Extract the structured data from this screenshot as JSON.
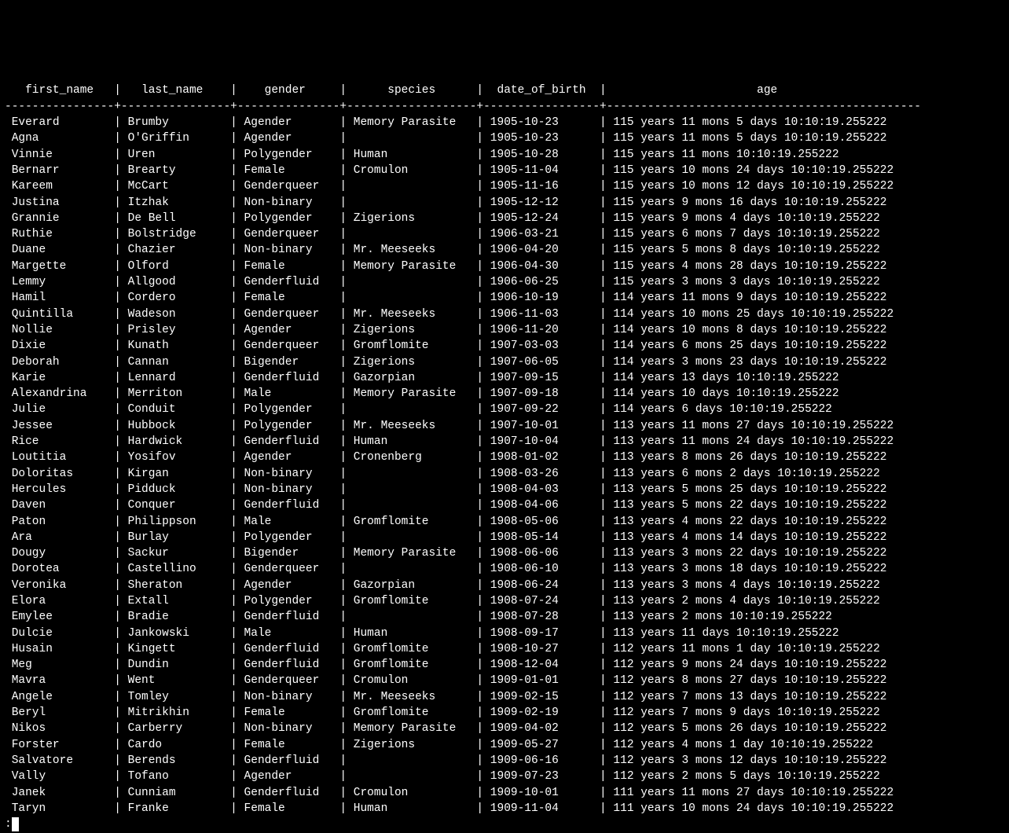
{
  "prompt": ":",
  "columns": [
    {
      "name": "first_name",
      "width": 14,
      "align": "left",
      "header_align": "center"
    },
    {
      "name": "last_name",
      "width": 14,
      "align": "left",
      "header_align": "center"
    },
    {
      "name": "gender",
      "width": 13,
      "align": "left",
      "header_align": "center"
    },
    {
      "name": "species",
      "width": 17,
      "align": "left",
      "header_align": "center"
    },
    {
      "name": "date_of_birth",
      "width": 15,
      "align": "left",
      "header_align": "center"
    },
    {
      "name": "age",
      "width": 45,
      "align": "left",
      "header_align": "center"
    }
  ],
  "rows": [
    {
      "first_name": "Everard",
      "last_name": "Brumby",
      "gender": "Agender",
      "species": "Memory Parasite",
      "date_of_birth": "1905-10-23",
      "age": "115 years 11 mons 5 days 10:10:19.255222"
    },
    {
      "first_name": "Agna",
      "last_name": "O'Griffin",
      "gender": "Agender",
      "species": "",
      "date_of_birth": "1905-10-23",
      "age": "115 years 11 mons 5 days 10:10:19.255222"
    },
    {
      "first_name": "Vinnie",
      "last_name": "Uren",
      "gender": "Polygender",
      "species": "Human",
      "date_of_birth": "1905-10-28",
      "age": "115 years 11 mons 10:10:19.255222"
    },
    {
      "first_name": "Bernarr",
      "last_name": "Brearty",
      "gender": "Female",
      "species": "Cromulon",
      "date_of_birth": "1905-11-04",
      "age": "115 years 10 mons 24 days 10:10:19.255222"
    },
    {
      "first_name": "Kareem",
      "last_name": "McCart",
      "gender": "Genderqueer",
      "species": "",
      "date_of_birth": "1905-11-16",
      "age": "115 years 10 mons 12 days 10:10:19.255222"
    },
    {
      "first_name": "Justina",
      "last_name": "Itzhak",
      "gender": "Non-binary",
      "species": "",
      "date_of_birth": "1905-12-12",
      "age": "115 years 9 mons 16 days 10:10:19.255222"
    },
    {
      "first_name": "Grannie",
      "last_name": "De Bell",
      "gender": "Polygender",
      "species": "Zigerions",
      "date_of_birth": "1905-12-24",
      "age": "115 years 9 mons 4 days 10:10:19.255222"
    },
    {
      "first_name": "Ruthie",
      "last_name": "Bolstridge",
      "gender": "Genderqueer",
      "species": "",
      "date_of_birth": "1906-03-21",
      "age": "115 years 6 mons 7 days 10:10:19.255222"
    },
    {
      "first_name": "Duane",
      "last_name": "Chazier",
      "gender": "Non-binary",
      "species": "Mr. Meeseeks",
      "date_of_birth": "1906-04-20",
      "age": "115 years 5 mons 8 days 10:10:19.255222"
    },
    {
      "first_name": "Margette",
      "last_name": "Olford",
      "gender": "Female",
      "species": "Memory Parasite",
      "date_of_birth": "1906-04-30",
      "age": "115 years 4 mons 28 days 10:10:19.255222"
    },
    {
      "first_name": "Lemmy",
      "last_name": "Allgood",
      "gender": "Genderfluid",
      "species": "",
      "date_of_birth": "1906-06-25",
      "age": "115 years 3 mons 3 days 10:10:19.255222"
    },
    {
      "first_name": "Hamil",
      "last_name": "Cordero",
      "gender": "Female",
      "species": "",
      "date_of_birth": "1906-10-19",
      "age": "114 years 11 mons 9 days 10:10:19.255222"
    },
    {
      "first_name": "Quintilla",
      "last_name": "Wadeson",
      "gender": "Genderqueer",
      "species": "Mr. Meeseeks",
      "date_of_birth": "1906-11-03",
      "age": "114 years 10 mons 25 days 10:10:19.255222"
    },
    {
      "first_name": "Nollie",
      "last_name": "Prisley",
      "gender": "Agender",
      "species": "Zigerions",
      "date_of_birth": "1906-11-20",
      "age": "114 years 10 mons 8 days 10:10:19.255222"
    },
    {
      "first_name": "Dixie",
      "last_name": "Kunath",
      "gender": "Genderqueer",
      "species": "Gromflomite",
      "date_of_birth": "1907-03-03",
      "age": "114 years 6 mons 25 days 10:10:19.255222"
    },
    {
      "first_name": "Deborah",
      "last_name": "Cannan",
      "gender": "Bigender",
      "species": "Zigerions",
      "date_of_birth": "1907-06-05",
      "age": "114 years 3 mons 23 days 10:10:19.255222"
    },
    {
      "first_name": "Karie",
      "last_name": "Lennard",
      "gender": "Genderfluid",
      "species": "Gazorpian",
      "date_of_birth": "1907-09-15",
      "age": "114 years 13 days 10:10:19.255222"
    },
    {
      "first_name": "Alexandrina",
      "last_name": "Merriton",
      "gender": "Male",
      "species": "Memory Parasite",
      "date_of_birth": "1907-09-18",
      "age": "114 years 10 days 10:10:19.255222"
    },
    {
      "first_name": "Julie",
      "last_name": "Conduit",
      "gender": "Polygender",
      "species": "",
      "date_of_birth": "1907-09-22",
      "age": "114 years 6 days 10:10:19.255222"
    },
    {
      "first_name": "Jessee",
      "last_name": "Hubbock",
      "gender": "Polygender",
      "species": "Mr. Meeseeks",
      "date_of_birth": "1907-10-01",
      "age": "113 years 11 mons 27 days 10:10:19.255222"
    },
    {
      "first_name": "Rice",
      "last_name": "Hardwick",
      "gender": "Genderfluid",
      "species": "Human",
      "date_of_birth": "1907-10-04",
      "age": "113 years 11 mons 24 days 10:10:19.255222"
    },
    {
      "first_name": "Loutitia",
      "last_name": "Yosifov",
      "gender": "Agender",
      "species": "Cronenberg",
      "date_of_birth": "1908-01-02",
      "age": "113 years 8 mons 26 days 10:10:19.255222"
    },
    {
      "first_name": "Doloritas",
      "last_name": "Kirgan",
      "gender": "Non-binary",
      "species": "",
      "date_of_birth": "1908-03-26",
      "age": "113 years 6 mons 2 days 10:10:19.255222"
    },
    {
      "first_name": "Hercules",
      "last_name": "Pidduck",
      "gender": "Non-binary",
      "species": "",
      "date_of_birth": "1908-04-03",
      "age": "113 years 5 mons 25 days 10:10:19.255222"
    },
    {
      "first_name": "Daven",
      "last_name": "Conquer",
      "gender": "Genderfluid",
      "species": "",
      "date_of_birth": "1908-04-06",
      "age": "113 years 5 mons 22 days 10:10:19.255222"
    },
    {
      "first_name": "Paton",
      "last_name": "Philippson",
      "gender": "Male",
      "species": "Gromflomite",
      "date_of_birth": "1908-05-06",
      "age": "113 years 4 mons 22 days 10:10:19.255222"
    },
    {
      "first_name": "Ara",
      "last_name": "Burlay",
      "gender": "Polygender",
      "species": "",
      "date_of_birth": "1908-05-14",
      "age": "113 years 4 mons 14 days 10:10:19.255222"
    },
    {
      "first_name": "Dougy",
      "last_name": "Sackur",
      "gender": "Bigender",
      "species": "Memory Parasite",
      "date_of_birth": "1908-06-06",
      "age": "113 years 3 mons 22 days 10:10:19.255222"
    },
    {
      "first_name": "Dorotea",
      "last_name": "Castellino",
      "gender": "Genderqueer",
      "species": "",
      "date_of_birth": "1908-06-10",
      "age": "113 years 3 mons 18 days 10:10:19.255222"
    },
    {
      "first_name": "Veronika",
      "last_name": "Sheraton",
      "gender": "Agender",
      "species": "Gazorpian",
      "date_of_birth": "1908-06-24",
      "age": "113 years 3 mons 4 days 10:10:19.255222"
    },
    {
      "first_name": "Elora",
      "last_name": "Extall",
      "gender": "Polygender",
      "species": "Gromflomite",
      "date_of_birth": "1908-07-24",
      "age": "113 years 2 mons 4 days 10:10:19.255222"
    },
    {
      "first_name": "Emylee",
      "last_name": "Bradie",
      "gender": "Genderfluid",
      "species": "",
      "date_of_birth": "1908-07-28",
      "age": "113 years 2 mons 10:10:19.255222"
    },
    {
      "first_name": "Dulcie",
      "last_name": "Jankowski",
      "gender": "Male",
      "species": "Human",
      "date_of_birth": "1908-09-17",
      "age": "113 years 11 days 10:10:19.255222"
    },
    {
      "first_name": "Husain",
      "last_name": "Kingett",
      "gender": "Genderfluid",
      "species": "Gromflomite",
      "date_of_birth": "1908-10-27",
      "age": "112 years 11 mons 1 day 10:10:19.255222"
    },
    {
      "first_name": "Meg",
      "last_name": "Dundin",
      "gender": "Genderfluid",
      "species": "Gromflomite",
      "date_of_birth": "1908-12-04",
      "age": "112 years 9 mons 24 days 10:10:19.255222"
    },
    {
      "first_name": "Mavra",
      "last_name": "Went",
      "gender": "Genderqueer",
      "species": "Cromulon",
      "date_of_birth": "1909-01-01",
      "age": "112 years 8 mons 27 days 10:10:19.255222"
    },
    {
      "first_name": "Angele",
      "last_name": "Tomley",
      "gender": "Non-binary",
      "species": "Mr. Meeseeks",
      "date_of_birth": "1909-02-15",
      "age": "112 years 7 mons 13 days 10:10:19.255222"
    },
    {
      "first_name": "Beryl",
      "last_name": "Mitrikhin",
      "gender": "Female",
      "species": "Gromflomite",
      "date_of_birth": "1909-02-19",
      "age": "112 years 7 mons 9 days 10:10:19.255222"
    },
    {
      "first_name": "Nikos",
      "last_name": "Carberry",
      "gender": "Non-binary",
      "species": "Memory Parasite",
      "date_of_birth": "1909-04-02",
      "age": "112 years 5 mons 26 days 10:10:19.255222"
    },
    {
      "first_name": "Forster",
      "last_name": "Cardo",
      "gender": "Female",
      "species": "Zigerions",
      "date_of_birth": "1909-05-27",
      "age": "112 years 4 mons 1 day 10:10:19.255222"
    },
    {
      "first_name": "Salvatore",
      "last_name": "Berends",
      "gender": "Genderfluid",
      "species": "",
      "date_of_birth": "1909-06-16",
      "age": "112 years 3 mons 12 days 10:10:19.255222"
    },
    {
      "first_name": "Vally",
      "last_name": "Tofano",
      "gender": "Agender",
      "species": "",
      "date_of_birth": "1909-07-23",
      "age": "112 years 2 mons 5 days 10:10:19.255222"
    },
    {
      "first_name": "Janek",
      "last_name": "Cunniam",
      "gender": "Genderfluid",
      "species": "Cromulon",
      "date_of_birth": "1909-10-01",
      "age": "111 years 11 mons 27 days 10:10:19.255222"
    },
    {
      "first_name": "Taryn",
      "last_name": "Franke",
      "gender": "Female",
      "species": "Human",
      "date_of_birth": "1909-11-04",
      "age": "111 years 10 mons 24 days 10:10:19.255222"
    }
  ]
}
